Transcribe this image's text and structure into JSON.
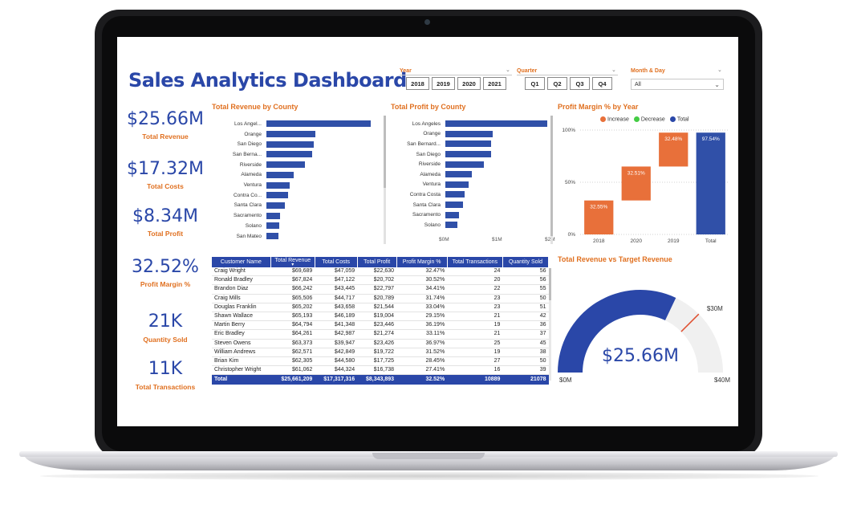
{
  "page": {
    "title": "Sales Analytics Dashboard"
  },
  "colors": {
    "accent_blue": "#2a47a8",
    "bar_blue": "#3050a8",
    "orange": "#e07020",
    "waterfall_orange": "#e8703a",
    "decrease_green": "#44cc44"
  },
  "slicers": {
    "year": {
      "label": "Year",
      "options": [
        "2018",
        "2019",
        "2020",
        "2021"
      ]
    },
    "quarter": {
      "label": "Quarter",
      "options": [
        "Q1",
        "Q2",
        "Q3",
        "Q4"
      ]
    },
    "month": {
      "label": "Month & Day",
      "value": "All"
    }
  },
  "kpis": [
    {
      "value": "$25.66M",
      "label": "Total Revenue"
    },
    {
      "value": "$17.32M",
      "label": "Total Costs"
    },
    {
      "value": "$8.34M",
      "label": "Total Profit"
    },
    {
      "value": "32.52%",
      "label": "Profit Margin %"
    },
    {
      "value": "21K",
      "label": "Quantity Sold"
    },
    {
      "value": "11K",
      "label": "Total Transactions"
    }
  ],
  "chart_data": [
    {
      "type": "bar",
      "orientation": "horizontal",
      "title": "Total Revenue by County",
      "categories": [
        "Los Angel...",
        "Orange",
        "San Diego",
        "San Berna...",
        "Riverside",
        "Alameda",
        "Ventura",
        "Contra Co...",
        "Santa Clara",
        "Sacramento",
        "Solano",
        "San Mateo"
      ],
      "values": [
        6.2,
        2.9,
        2.8,
        2.7,
        2.3,
        1.6,
        1.4,
        1.3,
        1.1,
        0.8,
        0.75,
        0.72
      ]
    },
    {
      "type": "bar",
      "orientation": "horizontal",
      "title": "Total Profit by County",
      "categories": [
        "Los Angeles",
        "Orange",
        "San Bernard...",
        "San Diego",
        "Riverside",
        "Alameda",
        "Ventura",
        "Contra Costa",
        "Santa Clara",
        "Sacramento",
        "Solano"
      ],
      "values": [
        1.92,
        0.9,
        0.87,
        0.86,
        0.72,
        0.5,
        0.44,
        0.36,
        0.34,
        0.25,
        0.22
      ],
      "x_ticks": [
        "$0M",
        "$1M",
        "$2M"
      ],
      "xlim": [
        0,
        2
      ]
    },
    {
      "type": "waterfall",
      "title": "Profit Margin % by Year",
      "legend": [
        "Increase",
        "Decrease",
        "Total"
      ],
      "categories": [
        "2018",
        "2020",
        "2019",
        "Total"
      ],
      "steps": [
        {
          "label": "32.55%",
          "start": 0,
          "end": 32.55
        },
        {
          "label": "32.51%",
          "start": 32.55,
          "end": 65.06
        },
        {
          "label": "32.48%",
          "start": 65.06,
          "end": 97.54
        },
        {
          "label": "97.54%",
          "start": 0,
          "end": 97.54
        }
      ],
      "y_ticks": [
        "0%",
        "50%",
        "100%"
      ],
      "ylim": [
        0,
        100
      ]
    },
    {
      "type": "gauge",
      "title": "Total Revenue vs Target Revenue",
      "value": 25.66,
      "target": 30,
      "min": 0,
      "max": 40,
      "value_label": "$25.66M",
      "min_label": "$0M",
      "max_label": "$40M",
      "target_label": "$30M"
    },
    {
      "type": "table",
      "columns": [
        "Customer Name",
        "Total Revenue",
        "Total Costs",
        "Total Profit",
        "Profit Margin %",
        "Total Transactions",
        "Quantity Sold"
      ],
      "rows": [
        [
          "Craig Wright",
          "$69,689",
          "$47,059",
          "$22,630",
          "32.47%",
          "24",
          "56"
        ],
        [
          "Ronald Bradley",
          "$67,824",
          "$47,122",
          "$20,702",
          "30.52%",
          "20",
          "56"
        ],
        [
          "Brandon Diaz",
          "$66,242",
          "$43,445",
          "$22,797",
          "34.41%",
          "22",
          "55"
        ],
        [
          "Craig Mills",
          "$65,506",
          "$44,717",
          "$20,789",
          "31.74%",
          "23",
          "50"
        ],
        [
          "Douglas Franklin",
          "$65,202",
          "$43,658",
          "$21,544",
          "33.04%",
          "23",
          "51"
        ],
        [
          "Shawn Wallace",
          "$65,193",
          "$46,189",
          "$19,004",
          "29.15%",
          "21",
          "42"
        ],
        [
          "Martin Berry",
          "$64,794",
          "$41,348",
          "$23,446",
          "36.19%",
          "19",
          "36"
        ],
        [
          "Eric Bradley",
          "$64,261",
          "$42,987",
          "$21,274",
          "33.11%",
          "21",
          "37"
        ],
        [
          "Steven Owens",
          "$63,373",
          "$39,947",
          "$23,426",
          "36.97%",
          "25",
          "45"
        ],
        [
          "William Andrews",
          "$62,571",
          "$42,849",
          "$19,722",
          "31.52%",
          "19",
          "38"
        ],
        [
          "Brian Kim",
          "$62,305",
          "$44,580",
          "$17,725",
          "28.45%",
          "27",
          "50"
        ],
        [
          "Christopher Wright",
          "$61,062",
          "$44,324",
          "$16,738",
          "27.41%",
          "16",
          "39"
        ]
      ],
      "total": [
        "Total",
        "$25,661,209",
        "$17,317,316",
        "$8,343,893",
        "32.52%",
        "10889",
        "21078"
      ]
    }
  ]
}
